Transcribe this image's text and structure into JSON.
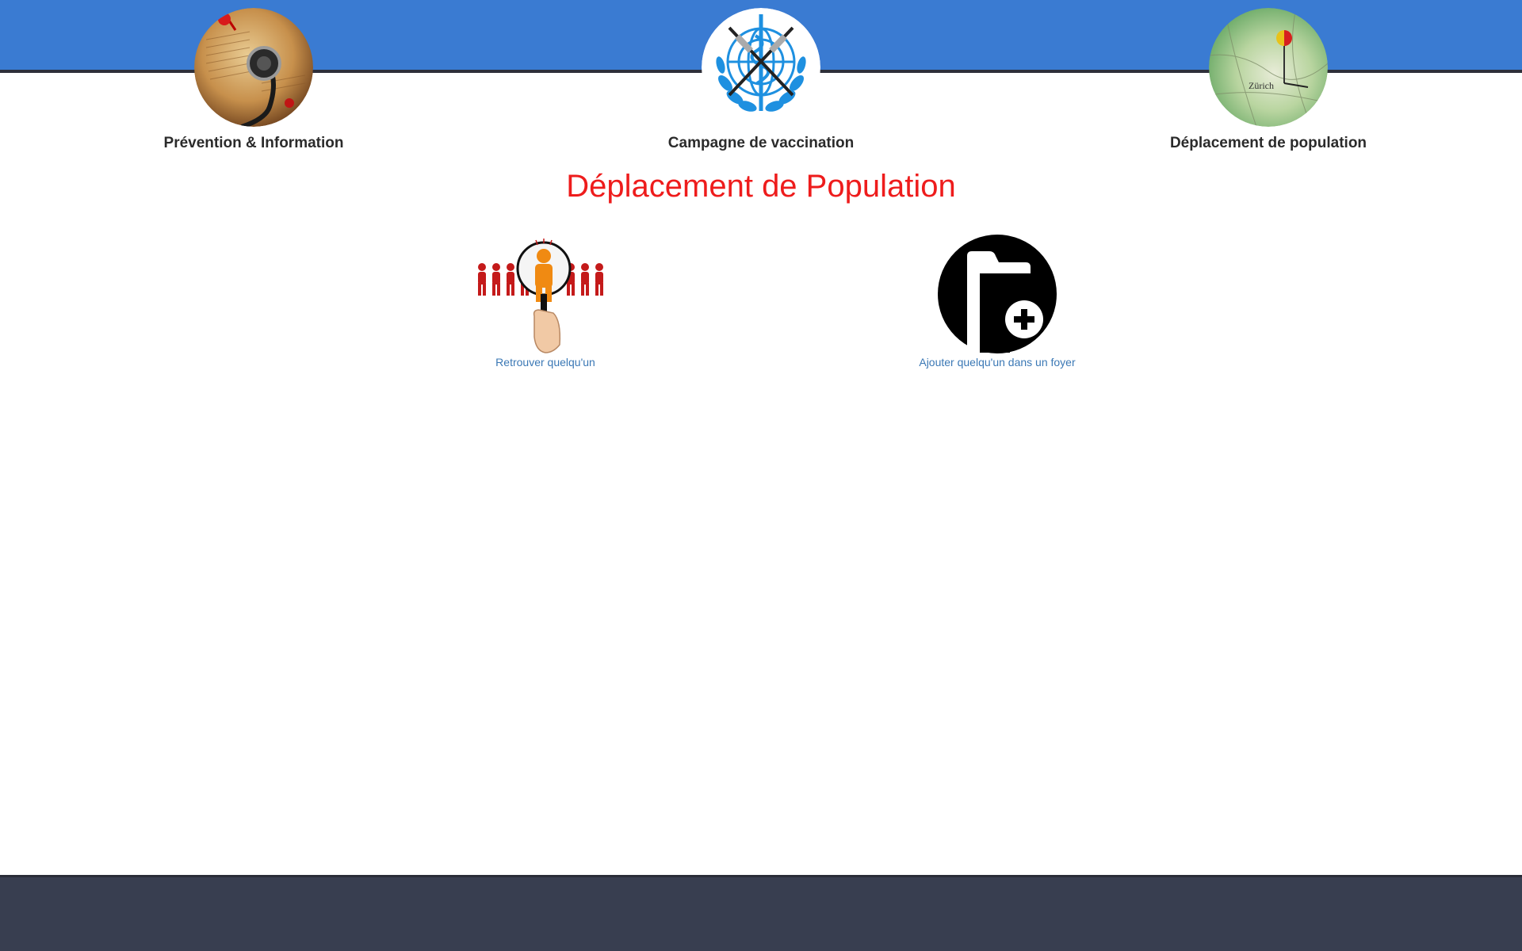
{
  "nav": {
    "items": [
      {
        "label": "Prévention & Information",
        "icon": "stethoscope-book-icon"
      },
      {
        "label": "Campagne de vaccination",
        "icon": "who-syringe-emblem-icon"
      },
      {
        "label": "Déplacement de population",
        "icon": "map-pin-zurich-icon"
      }
    ],
    "map_text": {
      "city": "Zürich"
    }
  },
  "heading": "Déplacement de Population",
  "actions": [
    {
      "label": "Retrouver quelqu'un",
      "icon": "magnifier-people-icon"
    },
    {
      "label": "Ajouter quelqu'un dans un foyer",
      "icon": "folder-add-icon"
    }
  ],
  "colors": {
    "header_blue": "#3a7bd2",
    "heading_red": "#ee1c1c",
    "link_blue": "#3b78b5",
    "footer_dark": "#383e50",
    "who_blue": "#1e90e0"
  }
}
